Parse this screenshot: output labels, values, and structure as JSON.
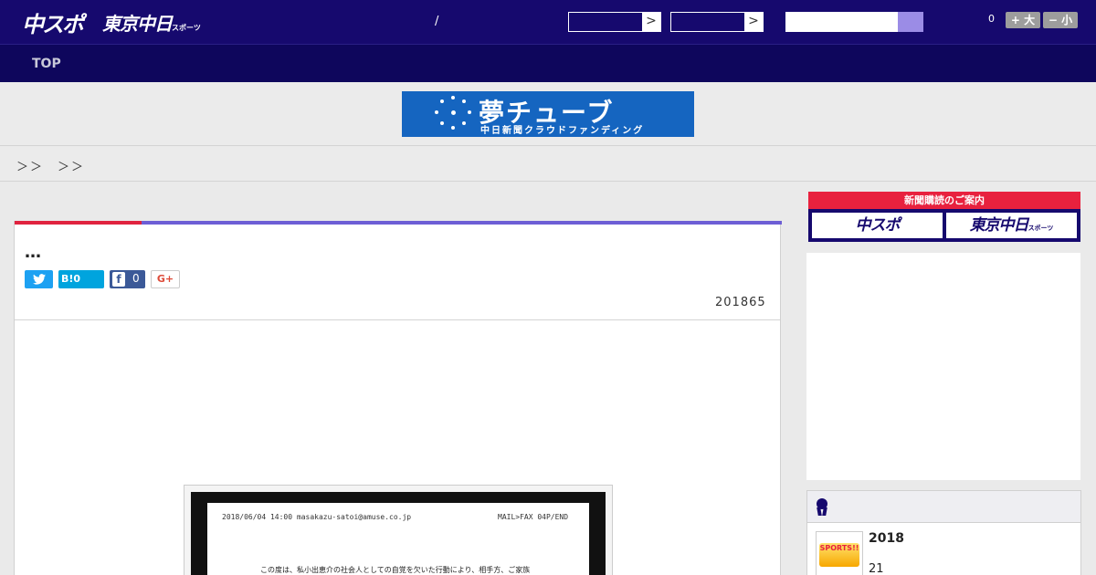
{
  "header": {
    "logo_primary": "中スポ",
    "logo_secondary": "東京中日",
    "logo_secondary_small": "スポーツ",
    "separator": "/",
    "select_arrow": ">",
    "count": "0",
    "font_large": "+ 大",
    "font_small": "− 小"
  },
  "nav": {
    "items": [
      "TOP"
    ]
  },
  "banner": {
    "title": "夢チューブ",
    "subtitle": "中日新聞クラウドファンディング"
  },
  "breadcrumb": {
    "text": "＞＞　＞＞"
  },
  "article": {
    "title": "…",
    "date": "201865",
    "share": {
      "twitter_icon": "twitter-icon",
      "hatena_label": "B!0",
      "facebook_icon": "f",
      "facebook_count": "0",
      "gplus_label": "G+"
    },
    "photo": {
      "header_left": "2018/06/04 14:00 masakazu-satoi@amuse.co.jp",
      "header_right": "MAIL>FAX  04P/END",
      "body": "この度は、私小出恵介の社会人としての自覚を欠いた行動により、相手方、ご家族"
    }
  },
  "sidebar": {
    "subscription_label": "新聞購読のご案内",
    "sub_button_1": "中スポ",
    "sub_button_2": "東京中日",
    "sub_button_2_small": "スポーツ",
    "ranking": {
      "title": "2018",
      "subtitle": "21",
      "thumb_text": "SPORTS!!"
    }
  },
  "colors": {
    "header_bg": "#16096e",
    "nav_bg": "#0e065c",
    "accent_red": "#e0233f",
    "accent_purple": "#6d5ed5",
    "banner_blue": "#1565c0"
  }
}
